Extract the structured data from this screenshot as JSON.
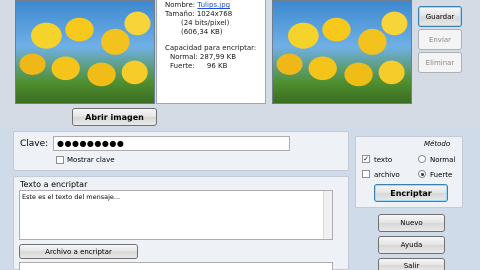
{
  "info": {
    "name_label": "Nombre:",
    "name_value": "Tulips.jpg",
    "size_label": "Tamaño:",
    "size_value": "1024x768",
    "bits": "(24 bits/pixel)",
    "kb": "(606,34 KB)",
    "capacity_label": "Capacidad para encriptar:",
    "normal_label": "Normal:",
    "normal_value": "287,99 KB",
    "fuerte_label": "Fuerte:",
    "fuerte_value": "96 KB"
  },
  "buttons": {
    "guardar": "Guardar",
    "enviar": "Enviar",
    "eliminar": "Eliminar",
    "abrir_imagen": "Abrir imagen",
    "encriptar": "Encriptar",
    "archivo_encriptar": "Archivo a encriptar",
    "nuevo": "Nuevo",
    "ayuda": "Ayuda",
    "salir": "Salir"
  },
  "clave": {
    "label": "Clave:",
    "value": "●●●●●●●●●",
    "mostrar": "Mostrar clave"
  },
  "texto": {
    "title": "Texto a encriptar",
    "value": "Este es el texto del mensaje..."
  },
  "metodo": {
    "title": "Método",
    "texto": "texto",
    "archivo": "archivo",
    "normal": "Normal",
    "fuerte": "Fuerte"
  }
}
